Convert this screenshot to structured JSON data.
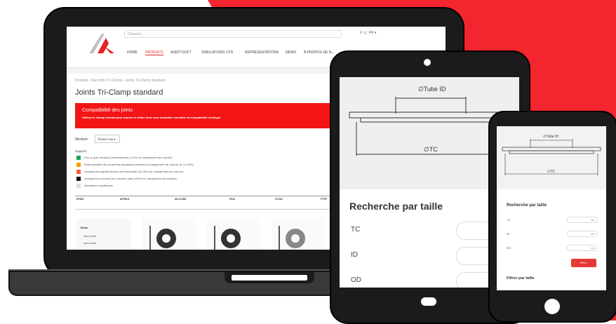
{
  "colors": {
    "accent": "#f3252e",
    "dark": "#1b1b1b",
    "banner": "#f31515"
  },
  "desktop": {
    "search_placeholder": "Cherche...",
    "top_icons": "⚲  🛒     FR ▾",
    "nav": [
      {
        "label": "HOME",
        "active": false
      },
      {
        "label": "PRODUITS",
        "active": true
      },
      {
        "label": "ASEPTSOFT",
        "active": false
      },
      {
        "label": "SIMULATIONS CFD",
        "active": false
      },
      {
        "label": "REPRÉSENTATIONS",
        "active": false
      },
      {
        "label": "NEWS",
        "active": false
      },
      {
        "label": "À PROPOS DE N...",
        "active": false
      }
    ],
    "breadcrumb": "Produits  ›  Raccords Tri-Clamp  ›  Joints Tri-Clamp standard",
    "page_title": "Joints Tri-Clamp standard",
    "compat_title": "Compatibilité des joints",
    "compat_sub": "Utilisez le champ suivant pour trouver le milieu dont vous souhaitez connaître la compatibilité chimique",
    "medium_label": "Medium:",
    "medium_select": "Choisir svp ▾",
    "support_label": "Support:",
    "legend": [
      {
        "color": "#1aa35a",
        "text": "Peu ou pas d'impact (recommandé) (<10% de changement de volume)"
      },
      {
        "color": "#f2a000",
        "text": "Perte possible des propriétés physiques (attention) (changement de volume de 10-20%)"
      },
      {
        "color": "#f0603a",
        "text": "changement significatif (non recommandé) (20-40% de changement de volume)"
      },
      {
        "color": "#111111",
        "text": "changement excessif (ne convient pas) (>40% de changement de volume)"
      },
      {
        "color": "#dddddd",
        "text": "information insuffisante"
      }
    ],
    "table_headers": [
      "EPDM",
      "NITRILE",
      "SILICONE",
      "FKM",
      "VITON",
      "PTFE"
    ],
    "filter_title": "Bride",
    "filter_options": [
      "avec bride",
      "sans bride"
    ]
  },
  "tablet": {
    "tube_id_label": "∅Tube ID",
    "tc_label": "∅TC",
    "search_title": "Recherche par taille",
    "fields": [
      "TC",
      "ID",
      "OD"
    ]
  },
  "phone": {
    "tube_id_label": "∅Tube ID",
    "tc_label": "∅TC",
    "search_title": "Recherche par taille",
    "fields": [
      {
        "label": "TC",
        "unit": "mm"
      },
      {
        "label": "ID",
        "unit": "mm"
      },
      {
        "label": "OD",
        "unit": "mm"
      }
    ],
    "button": "Filtrer",
    "filter_title": "Filtrer par taille"
  }
}
